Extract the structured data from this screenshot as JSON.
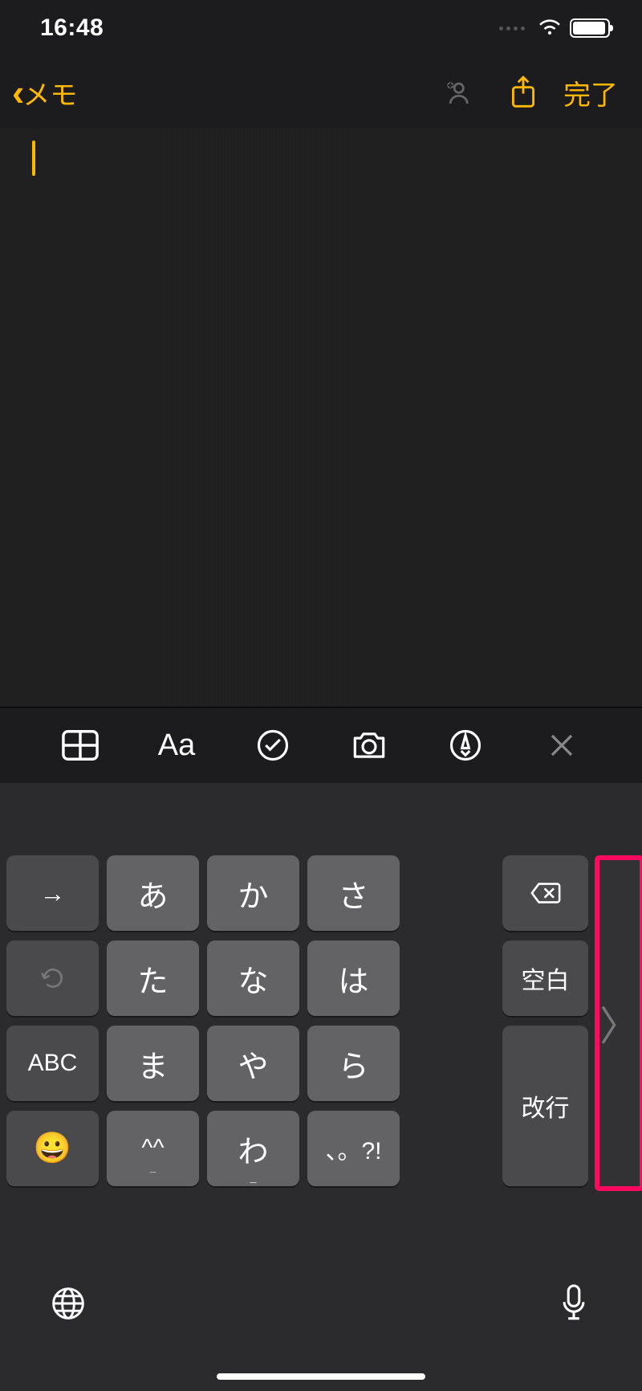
{
  "status": {
    "time": "16:48"
  },
  "nav": {
    "back_label": "メモ",
    "done_label": "完了"
  },
  "toolbar": {
    "table": "table",
    "format": "Aa",
    "check": "check",
    "camera": "camera",
    "pen": "pen",
    "close": "close"
  },
  "keyboard": {
    "rows": [
      [
        {
          "label": "→",
          "dark": true,
          "name": "tab-key"
        },
        {
          "label": "あ",
          "name": "kana-a"
        },
        {
          "label": "か",
          "name": "kana-ka"
        },
        {
          "label": "さ",
          "name": "kana-sa"
        }
      ],
      [
        {
          "label": "↺",
          "dark": true,
          "name": "undo-key",
          "dim": true
        },
        {
          "label": "た",
          "name": "kana-ta"
        },
        {
          "label": "な",
          "name": "kana-na"
        },
        {
          "label": "は",
          "name": "kana-ha"
        }
      ],
      [
        {
          "label": "ABC",
          "dark": true,
          "name": "abc-key",
          "small": true
        },
        {
          "label": "ま",
          "name": "kana-ma"
        },
        {
          "label": "や",
          "name": "kana-ya"
        },
        {
          "label": "ら",
          "name": "kana-ra"
        }
      ],
      [
        {
          "label": "😀",
          "dark": true,
          "name": "emoji-key"
        },
        {
          "label": "^^",
          "name": "kana-symbols",
          "sub": "¯"
        },
        {
          "label": "わ",
          "name": "kana-wa",
          "sub": "_"
        },
        {
          "label": "、。?!",
          "name": "kana-punct",
          "small": true
        }
      ]
    ],
    "side": {
      "delete": "⌫",
      "space": "空白",
      "return": "改行"
    },
    "expand": "〉"
  }
}
